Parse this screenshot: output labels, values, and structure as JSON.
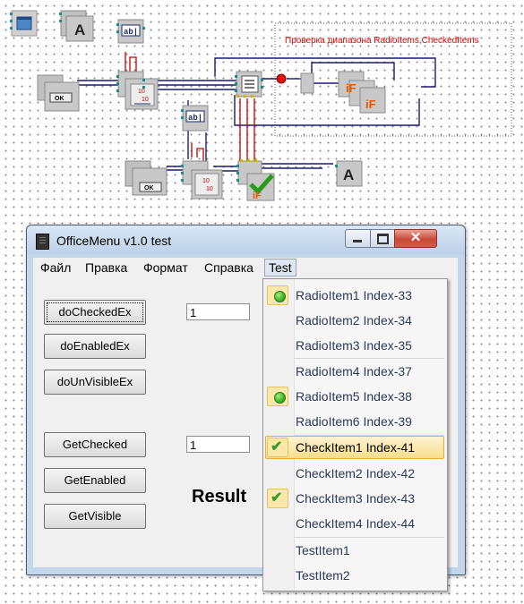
{
  "schema": {
    "caption": "Проверка диапазона RadioItems,CheckedItems",
    "ok_label": "OK",
    "icons": [
      "form-icon",
      "label-icon",
      "edit-icon",
      "button-icon",
      "counter-icon",
      "if-icon",
      "check-icon",
      "hub-icon"
    ]
  },
  "window": {
    "title": "OfficeMenu v1.0 test",
    "controls": {
      "minimize": "minimize",
      "maximize": "maximize",
      "close": "✕"
    }
  },
  "menubar": {
    "items": [
      "Файл",
      "Правка",
      "Формат",
      "Справка",
      "Test"
    ],
    "active": "Test"
  },
  "buttons": {
    "do_checked": "doCheckedEx",
    "do_enabled": "doEnabledEx",
    "do_unvisible": "doUnVisibleEx",
    "get_checked": "GetChecked",
    "get_enabled": "GetEnabled",
    "get_visible": "GetVisible"
  },
  "inputs": {
    "top_value": "1",
    "bottom_value": "1"
  },
  "result_label": "Result",
  "popup": {
    "items": [
      {
        "label": "RadioItem1 Index-33",
        "mark": "radio"
      },
      {
        "label": "RadioItem2 Index-34",
        "mark": ""
      },
      {
        "label": "RadioItem3 Index-35",
        "mark": ""
      },
      {
        "label": "RadioItem4 Index-37",
        "mark": ""
      },
      {
        "label": "RadioItem5 Index-38",
        "mark": "radio"
      },
      {
        "label": "RadioItem6 Index-39",
        "mark": ""
      },
      {
        "label": "CheckItem1 Index-41",
        "mark": "check",
        "highlighted": true
      },
      {
        "label": "CheckItem2 Index-42",
        "mark": ""
      },
      {
        "label": "CheckItem3 Index-43",
        "mark": "check"
      },
      {
        "label": "CheckItem4 Index-44",
        "mark": ""
      },
      {
        "label": "TestItem1",
        "mark": ""
      },
      {
        "label": "TestItem2",
        "mark": ""
      }
    ]
  },
  "colors": {
    "accent_highlight": "#f8de8a",
    "caption_red": "#e00000",
    "wire": "#1a1a6e",
    "wire_red": "#c00000"
  }
}
